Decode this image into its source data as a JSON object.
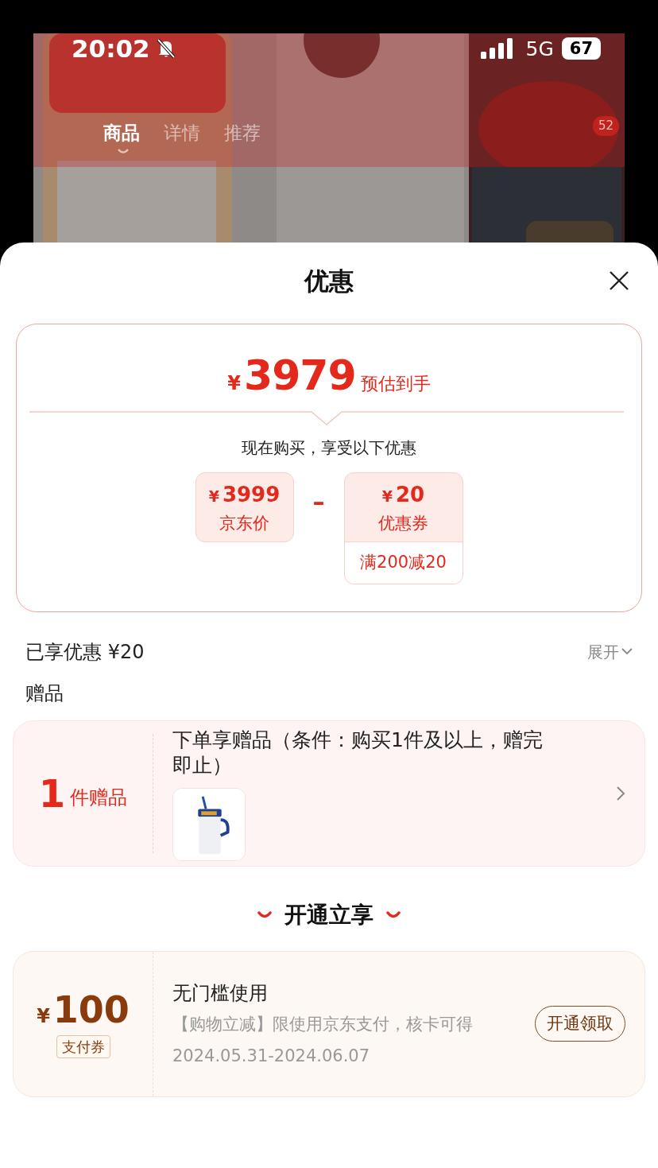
{
  "status_bar": {
    "time": "20:02",
    "network": "5G",
    "battery": "67"
  },
  "background_page": {
    "tabs": [
      {
        "label": "商品",
        "selected": true
      },
      {
        "label": "详情",
        "selected": false
      },
      {
        "label": "推荐",
        "selected": false
      }
    ],
    "cart_badge": "52"
  },
  "sheet": {
    "title": "优惠",
    "estimate": {
      "currency": "¥",
      "price": "3979",
      "label": "预估到手",
      "intro": "现在购买，享受以下优惠",
      "operator": "–",
      "terms": [
        {
          "kind": "price",
          "currency": "¥",
          "amount": "3999",
          "label": "京东价"
        },
        {
          "kind": "coupon",
          "currency": "¥",
          "amount": "20",
          "label": "优惠券",
          "condition": "满200减20"
        }
      ]
    },
    "savings": {
      "label": "已享优惠 ¥20",
      "toggle": "展开",
      "expanded": false
    },
    "gifts": {
      "heading": "赠品",
      "count": "1",
      "count_label": "件赠品",
      "description": "下单享赠品（条件：购买1件及以上，赠完即止）"
    },
    "activate": {
      "heading": "开通立享",
      "coupons": [
        {
          "currency": "¥",
          "amount": "100",
          "type": "支付券",
          "title": "无门槛使用",
          "description": "【购物立减】限使用京东支付，核卡可得",
          "validity": "2024.05.31-2024.06.07",
          "button": "开通领取"
        }
      ]
    }
  }
}
